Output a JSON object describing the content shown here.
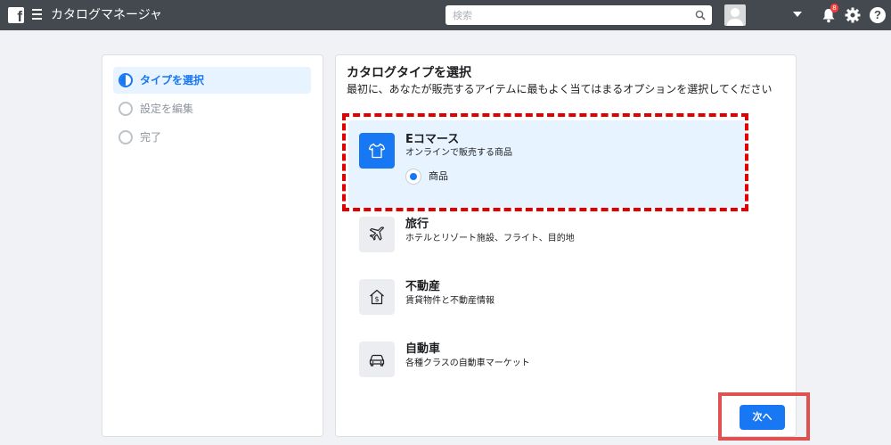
{
  "topbar": {
    "app_title": "カタログマネージャ",
    "search_placeholder": "検索",
    "notification_count": "8",
    "help_label": "?"
  },
  "steps": [
    {
      "label": "タイプを選択",
      "state": "current"
    },
    {
      "label": "設定を編集",
      "state": "pending"
    },
    {
      "label": "完了",
      "state": "pending"
    }
  ],
  "main": {
    "title": "カタログタイプを選択",
    "subtitle": "最初に、あなたが販売するアイテムに最もよく当てはまるオプションを選択してください",
    "options": [
      {
        "title": "Eコマース",
        "description": "オンラインで販売する商品",
        "icon": "t-shirt-icon",
        "selected": true,
        "sub_option": "商品"
      },
      {
        "title": "旅行",
        "description": "ホテルとリゾート施設、フライト、目的地",
        "icon": "airplane-icon",
        "selected": false
      },
      {
        "title": "不動産",
        "description": "賃貸物件と不動産情報",
        "icon": "house-dollar-icon",
        "selected": false
      },
      {
        "title": "自動車",
        "description": "各種クラスの自動車マーケット",
        "icon": "car-icon",
        "selected": false
      }
    ],
    "next_label": "次へ"
  },
  "colors": {
    "accent": "#1877f2",
    "topbar": "#444950",
    "highlight": "#e00000"
  }
}
